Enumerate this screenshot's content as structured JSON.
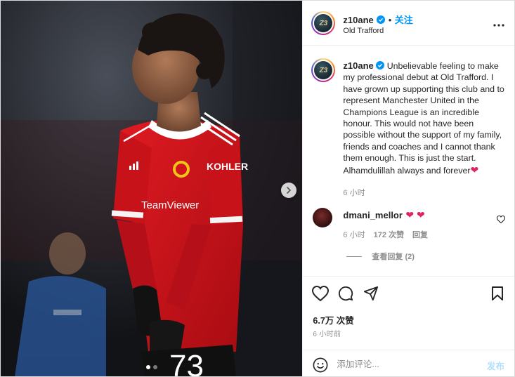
{
  "post": {
    "carousel": {
      "total_slides": 2,
      "active_slide": 1
    }
  },
  "header": {
    "avatar_monogram": "Z3",
    "username": "z10ane",
    "separator": "•",
    "follow_label": "关注",
    "location": "Old Trafford"
  },
  "photo": {
    "sponsor_text": "KOHLER",
    "brand_text": "TeamViewer",
    "shirt_number": "73"
  },
  "caption": {
    "username": "z10ane",
    "text": "Unbelievable feeling to make my professional debut at Old Trafford. I have grown up supporting this club and to represent Manchester United in the Champions League is an incredible honour. This would not have been possible without the support of my family, friends and coaches and I cannot thank them enough. This is just the start. Alhamdulillah always and forever",
    "emoji": "❤",
    "time": "6 小时"
  },
  "comments": [
    {
      "username": "dmani_mellor",
      "emoji": "❤ ❤",
      "time": "6 小时",
      "likes": "172 次赞",
      "reply_label": "回复"
    }
  ],
  "view_replies_label": "查看回复 (2)",
  "likes_label": "6.7万 次赞",
  "time_ago": "6 小时前",
  "comment_bar": {
    "placeholder": "添加评论...",
    "post_label": "发布"
  },
  "colors": {
    "accent": "#0095f6",
    "post_disabled": "#b2dffc",
    "heart_red": "#e0245e",
    "kit_red": "#d3141c"
  },
  "icons": {
    "header_more": "more-horizontal-icon",
    "verified": "verified-badge-icon",
    "like": "heart-outline-icon",
    "comment": "comment-bubble-icon",
    "share": "paper-plane-icon",
    "save": "bookmark-icon",
    "emoji": "smiley-icon",
    "next": "chevron-right-icon"
  }
}
